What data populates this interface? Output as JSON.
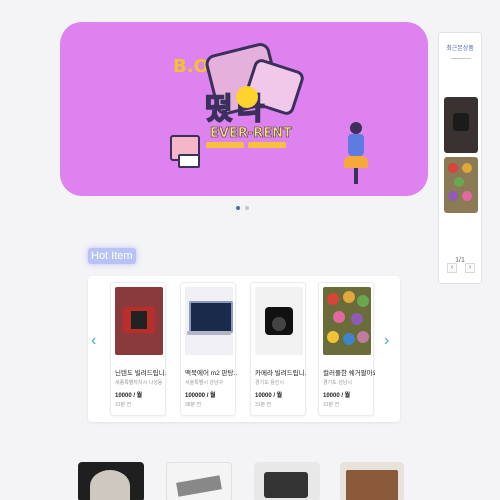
{
  "banner": {
    "headline": "떴다",
    "logo_text": "EVER-RENT",
    "corner_text": "B.O"
  },
  "banner_dots": {
    "count": 2,
    "active": 1
  },
  "recent": {
    "title": "최근본상품",
    "page": "1/1",
    "prev": "‹",
    "next": "›"
  },
  "hot_item": {
    "label": "Hot Item",
    "prev": "‹",
    "next": "›",
    "items": [
      {
        "name": "닌텐도 빌려드립니...",
        "location": "세종특별자치시 나성동",
        "price": "10000 / 월",
        "ago": "31분 전"
      },
      {
        "name": "맥북에어 m2 판탕...",
        "location": "서울특별시 강남구",
        "price": "100000 / 월",
        "ago": "38분 전"
      },
      {
        "name": "카메라 빌려드립니...",
        "location": "경기도 용인시",
        "price": "10000 / 월",
        "ago": "31분 전"
      },
      {
        "name": "컬러풀한 쉐거팔아요",
        "location": "경기도 성남시",
        "price": "10000 / 월",
        "ago": "31분 전"
      }
    ]
  }
}
